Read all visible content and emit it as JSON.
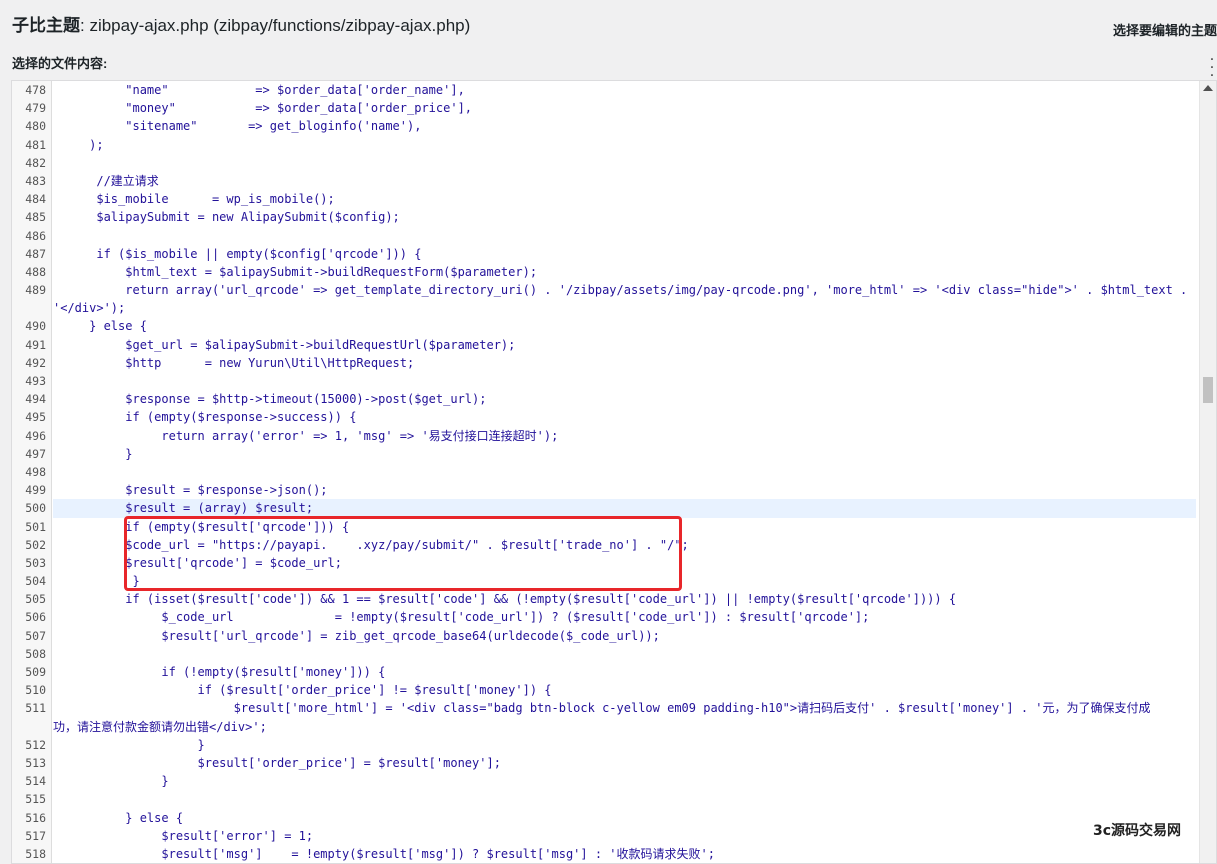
{
  "header": {
    "theme_label": "子比主题",
    "file_title": ": zibpay-ajax.php (zibpay/functions/zibpay-ajax.php)",
    "right_label": "选择要编辑的主题"
  },
  "file_content_label": "选择的文件内容:",
  "watermark": "3c源码交易网",
  "code_lines": [
    {
      "n": "478",
      "t": "          \"name\"            => $order_data['order_name'],"
    },
    {
      "n": "479",
      "t": "          \"money\"           => $order_data['order_price'],"
    },
    {
      "n": "480",
      "t": "          \"sitename\"       => get_bloginfo('name'),"
    },
    {
      "n": "481",
      "t": "     );"
    },
    {
      "n": "482",
      "t": ""
    },
    {
      "n": "483",
      "t": "      //建立请求"
    },
    {
      "n": "484",
      "t": "      $is_mobile      = wp_is_mobile();"
    },
    {
      "n": "485",
      "t": "      $alipaySubmit = new AlipaySubmit($config);"
    },
    {
      "n": "486",
      "t": ""
    },
    {
      "n": "487",
      "t": "      if ($is_mobile || empty($config['qrcode'])) {"
    },
    {
      "n": "488",
      "t": "          $html_text = $alipaySubmit->buildRequestForm($parameter);"
    },
    {
      "n": "489",
      "t": "          return array('url_qrcode' => get_template_directory_uri() . '/zibpay/assets/img/pay-qrcode.png', 'more_html' => '<div class=\"hide\">' . $html_text ."
    },
    {
      "n": "",
      "t": "'</div>');"
    },
    {
      "n": "490",
      "t": "     } else {"
    },
    {
      "n": "491",
      "t": "          $get_url = $alipaySubmit->buildRequestUrl($parameter);"
    },
    {
      "n": "492",
      "t": "          $http      = new Yurun\\Util\\HttpRequest;"
    },
    {
      "n": "493",
      "t": ""
    },
    {
      "n": "494",
      "t": "          $response = $http->timeout(15000)->post($get_url);"
    },
    {
      "n": "495",
      "t": "          if (empty($response->success)) {"
    },
    {
      "n": "496",
      "t": "               return array('error' => 1, 'msg' => '易支付接口连接超时');"
    },
    {
      "n": "497",
      "t": "          }"
    },
    {
      "n": "498",
      "t": ""
    },
    {
      "n": "499",
      "t": "          $result = $response->json();"
    },
    {
      "n": "500",
      "t": "          $result = (array) $result;"
    },
    {
      "n": "501",
      "t": "          if (empty($result['qrcode'])) {"
    },
    {
      "n": "502",
      "t": "          $code_url = \"https://payapi.    .xyz/pay/submit/\" . $result['trade_no'] . \"/\";"
    },
    {
      "n": "503",
      "t": "          $result['qrcode'] = $code_url;"
    },
    {
      "n": "504",
      "t": "           }"
    },
    {
      "n": "505",
      "t": "          if (isset($result['code']) && 1 == $result['code'] && (!empty($result['code_url']) || !empty($result['qrcode']))) {"
    },
    {
      "n": "506",
      "t": "               $_code_url              = !empty($result['code_url']) ? ($result['code_url']) : $result['qrcode'];"
    },
    {
      "n": "507",
      "t": "               $result['url_qrcode'] = zib_get_qrcode_base64(urldecode($_code_url));"
    },
    {
      "n": "508",
      "t": ""
    },
    {
      "n": "509",
      "t": "               if (!empty($result['money'])) {"
    },
    {
      "n": "510",
      "t": "                    if ($result['order_price'] != $result['money']) {"
    },
    {
      "n": "511",
      "t": "                         $result['more_html'] = '<div class=\"badg btn-block c-yellow em09 padding-h10\">请扫码后支付' . $result['money'] . '元，为了确保支付成"
    },
    {
      "n": "",
      "t": "功，请注意付款金额请勿出错</div>';"
    },
    {
      "n": "512",
      "t": "                    }"
    },
    {
      "n": "513",
      "t": "                    $result['order_price'] = $result['money'];"
    },
    {
      "n": "514",
      "t": "               }"
    },
    {
      "n": "515",
      "t": ""
    },
    {
      "n": "516",
      "t": "          } else {"
    },
    {
      "n": "517",
      "t": "               $result['error'] = 1;"
    },
    {
      "n": "518",
      "t": "               $result['msg']    = !empty($result['msg']) ? $result['msg'] : '收款码请求失败';"
    }
  ],
  "active_line": "500"
}
